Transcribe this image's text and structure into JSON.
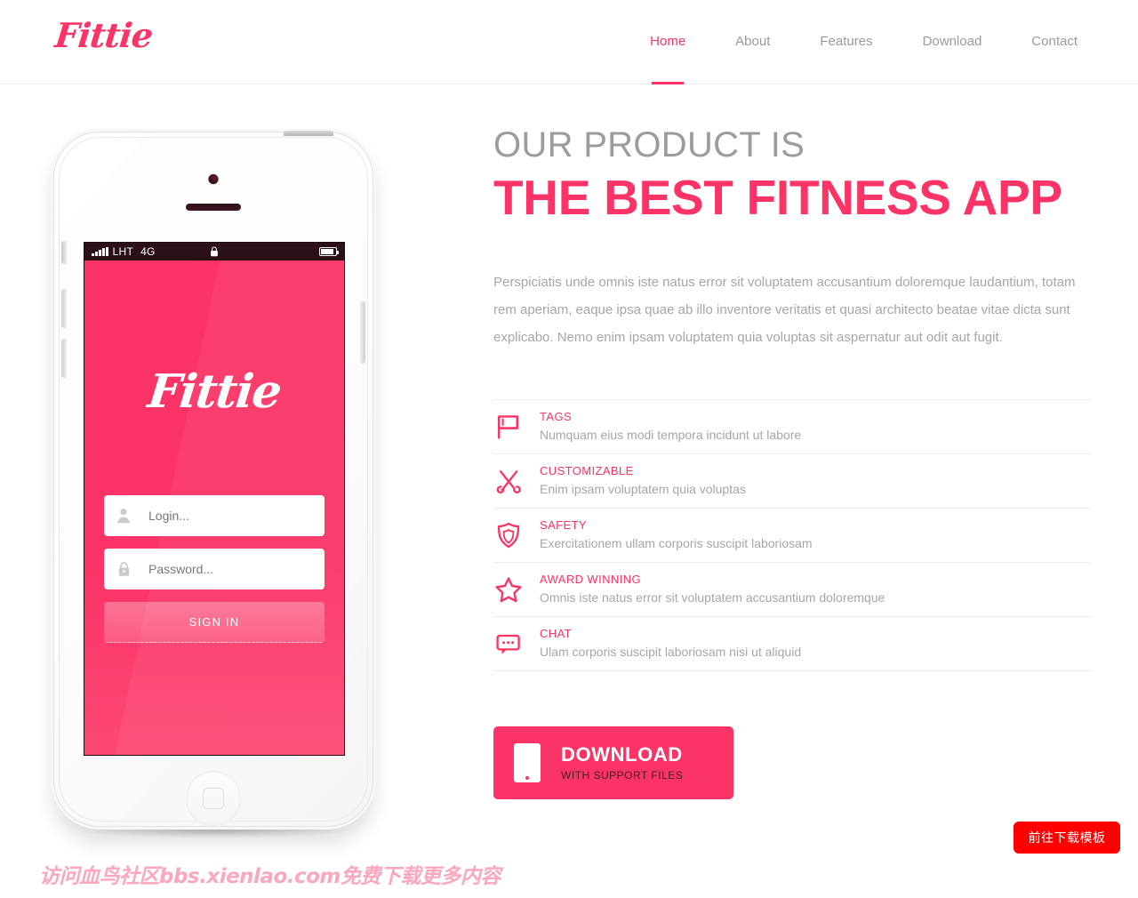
{
  "header": {
    "logo": "Fittie",
    "nav": [
      {
        "label": "Home",
        "active": true
      },
      {
        "label": "About",
        "active": false
      },
      {
        "label": "Features",
        "active": false
      },
      {
        "label": "Download",
        "active": false
      },
      {
        "label": "Contact",
        "active": false
      }
    ]
  },
  "phone": {
    "status_bar": {
      "carrier": "LHT",
      "network": "4G",
      "signal_icon": "signal-bars-icon",
      "lock_icon": "lock-icon",
      "battery_icon": "battery-icon"
    },
    "app_logo": "Fittie",
    "login": {
      "username_placeholder": "Login...",
      "username_icon": "user-icon",
      "password_placeholder": "Password...",
      "password_icon": "lock-icon",
      "submit_label": "SIGN IN"
    }
  },
  "hero": {
    "subheadline": "OUR PRODUCT IS",
    "headline": "THE BEST FITNESS APP",
    "paragraph": "Perspiciatis unde omnis iste natus error sit voluptatem accusantium doloremque laudantium, totam rem aperiam, eaque ipsa quae ab illo inventore veritatis et quasi architecto beatae vitae dicta sunt explicabo. Nemo enim ipsam voluptatem quia voluptas sit aspernatur aut odit aut fugit."
  },
  "features": [
    {
      "icon": "flag-icon",
      "title": "TAGS",
      "desc": "Numquam eius modi tempora incidunt ut labore"
    },
    {
      "icon": "tools-icon",
      "title": "CUSTOMIZABLE",
      "desc": "Enim ipsam voluptatem quia voluptas"
    },
    {
      "icon": "shield-icon",
      "title": "SAFETY",
      "desc": "Exercitationem ullam corporis suscipit laboriosam"
    },
    {
      "icon": "star-icon",
      "title": "AWARD WINNING",
      "desc": "Omnis iste natus error sit voluptatem accusantium doloremque"
    },
    {
      "icon": "chat-icon",
      "title": "CHAT",
      "desc": "Ulam corporis suscipit laboriosam nisi ut aliquid"
    }
  ],
  "download": {
    "icon": "mobile-phone-icon",
    "title": "DOWNLOAD",
    "subtitle": "WITH SUPPORT FILES"
  },
  "watermark": "访问血鸟社区bbs.xienlao.com免费下载更多内容",
  "float_cta": "前往下载模板",
  "colors": {
    "brand_pink": "#fb3366",
    "muted_gray": "#a6a6a6",
    "heading_gray": "#9c9c9c",
    "divider": "#ededed",
    "cta_red": "#ff0000",
    "watermark_pink": "#fba7bd"
  }
}
